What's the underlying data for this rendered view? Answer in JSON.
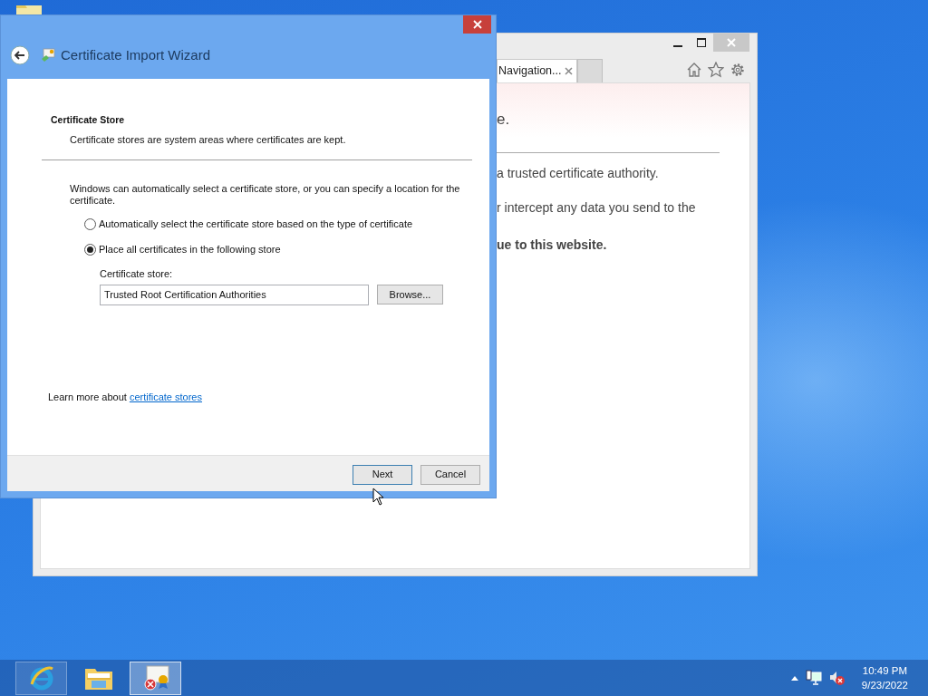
{
  "browser": {
    "tabs": [
      {
        "label": "Navigation...",
        "selected": true
      }
    ],
    "content": [
      {
        "kind": "heading",
        "text": "e."
      },
      {
        "kind": "text",
        "text": "a trusted certificate authority."
      },
      {
        "kind": "text",
        "text": "r intercept any data you send to the"
      },
      {
        "kind": "bold",
        "text": "ue to this website."
      }
    ]
  },
  "wizard": {
    "title": "Certificate Import Wizard",
    "heading": "Certificate Store",
    "subheading": "Certificate stores are system areas where certificates are kept.",
    "intro": "Windows can automatically select a certificate store, or you can specify a location for the certificate.",
    "options": [
      {
        "label": "Automatically select the certificate store based on the type of certificate",
        "selected": false
      },
      {
        "label": "Place all certificates in the following store",
        "selected": true
      }
    ],
    "store_label": "Certificate store:",
    "store_value": "Trusted Root Certification Authorities",
    "browse_button": "Browse...",
    "learn_more": {
      "text": "Learn more about",
      "link": "certificate stores"
    },
    "buttons": [
      {
        "label": "Next",
        "default": true
      },
      {
        "label": "Cancel",
        "default": false
      }
    ]
  },
  "taskbar": {
    "apps": [
      {
        "kind": "browser",
        "running": true,
        "selected": false
      },
      {
        "kind": "folder",
        "running": false,
        "selected": false
      },
      {
        "kind": "certificate",
        "running": true,
        "selected": true
      }
    ],
    "time": "10:49 PM",
    "date": "9/23/2022"
  }
}
